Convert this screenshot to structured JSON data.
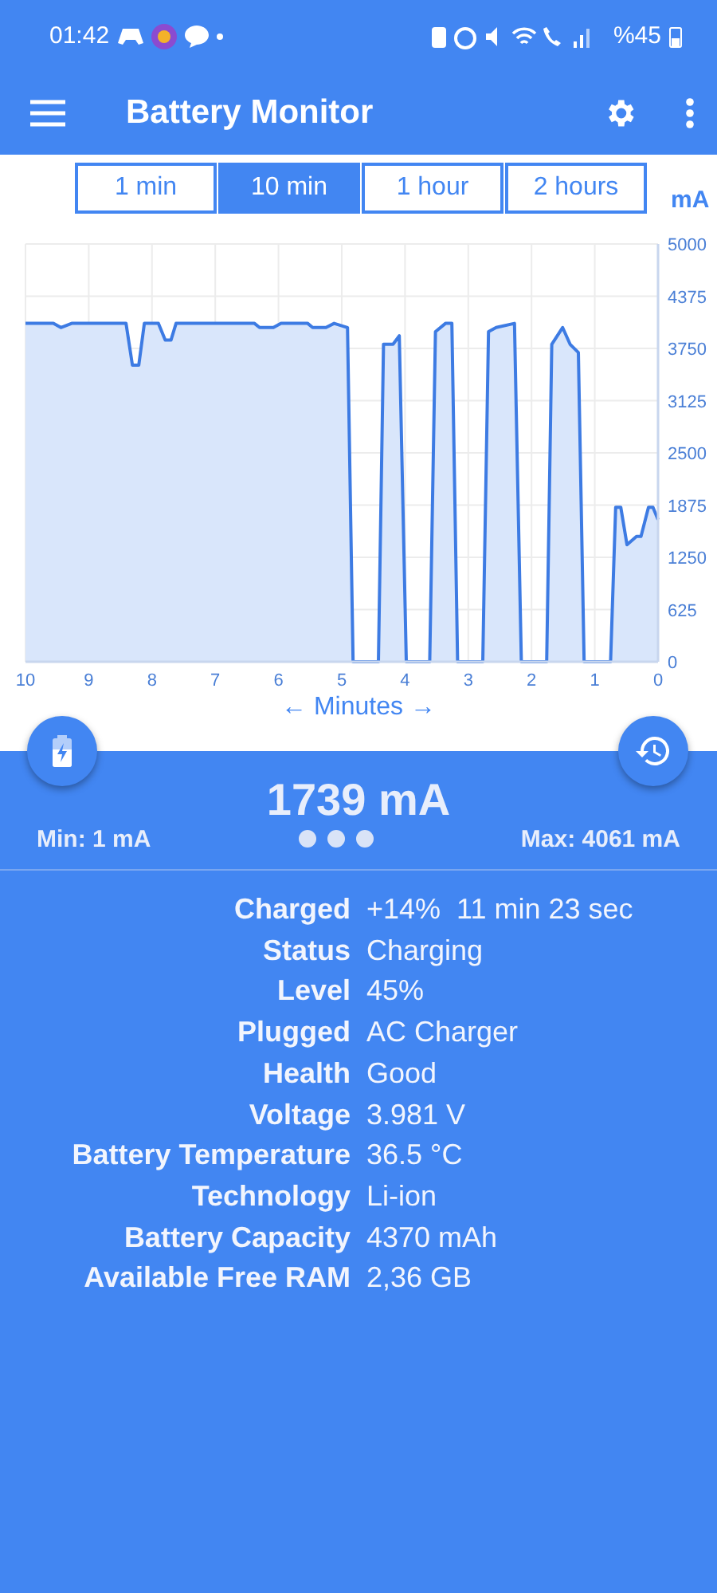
{
  "status_bar": {
    "time": "01:42",
    "battery": "%45"
  },
  "app_bar": {
    "title": "Battery Monitor"
  },
  "tabs": [
    {
      "label": "1 min",
      "selected": false
    },
    {
      "label": "10 min",
      "selected": true
    },
    {
      "label": "1 hour",
      "selected": false
    },
    {
      "label": "2 hours",
      "selected": false
    }
  ],
  "chart": {
    "chart_data": {
      "type": "area",
      "xlabel": "← Minutes →",
      "ylabel": "mA",
      "x": [
        10,
        9.56,
        9.44,
        9.27,
        8.41,
        8.31,
        8.21,
        8.12,
        7.9,
        7.79,
        7.7,
        7.62,
        6.38,
        6.3,
        6.08,
        5.96,
        5.54,
        5.46,
        5.25,
        5.12,
        4.91,
        4.82,
        4.42,
        4.34,
        4.19,
        4.09,
        3.98,
        3.61,
        3.52,
        3.36,
        3.26,
        3.17,
        2.77,
        2.68,
        2.56,
        2.27,
        2.16,
        1.76,
        1.68,
        1.51,
        1.39,
        1.26,
        1.17,
        0.75,
        0.67,
        0.59,
        0.49,
        0.34,
        0.27,
        0.15,
        0.08,
        0
      ],
      "series": [
        {
          "color": "#3d7be3",
          "values": [
            4050,
            4050,
            4000,
            4050,
            4050,
            3550,
            3550,
            4050,
            4050,
            3850,
            3850,
            4050,
            4050,
            4000,
            4000,
            4050,
            4050,
            4000,
            4000,
            4050,
            4000,
            0,
            0,
            3800,
            3800,
            3900,
            0,
            0,
            3950,
            4050,
            4050,
            0,
            0,
            3950,
            4000,
            4050,
            0,
            0,
            3800,
            4000,
            3800,
            3700,
            0,
            0,
            1850,
            1850,
            1400,
            1500,
            1500,
            1850,
            1850,
            1700
          ]
        }
      ],
      "grid": true,
      "xlim": [
        10,
        0
      ],
      "ylim": [
        0,
        5000
      ],
      "xticks": [
        10,
        9,
        8,
        7,
        6,
        5,
        4,
        3,
        2,
        1,
        0
      ],
      "yticks": [
        0,
        625,
        1250,
        1875,
        2500,
        3125,
        3750,
        4375,
        5000
      ]
    }
  },
  "current": {
    "value": "1739 mA",
    "min": "Min: 1 mA",
    "max": "Max: 4061 mA"
  },
  "info": [
    {
      "label": "Charged",
      "value": "+14%  11 min 23 sec"
    },
    {
      "label": "Status",
      "value": "Charging"
    },
    {
      "label": "Level",
      "value": "45%"
    },
    {
      "label": "Plugged",
      "value": "AC Charger"
    },
    {
      "label": "Health",
      "value": "Good"
    },
    {
      "label": "Voltage",
      "value": "3.981 V"
    },
    {
      "label": "Battery Temperature",
      "value": "36.5 °C"
    },
    {
      "label": "Technology",
      "value": "Li-ion"
    },
    {
      "label": "Battery Capacity",
      "value": "4370 mAh"
    },
    {
      "label": "Available Free RAM",
      "value": "2,36 GB"
    }
  ]
}
